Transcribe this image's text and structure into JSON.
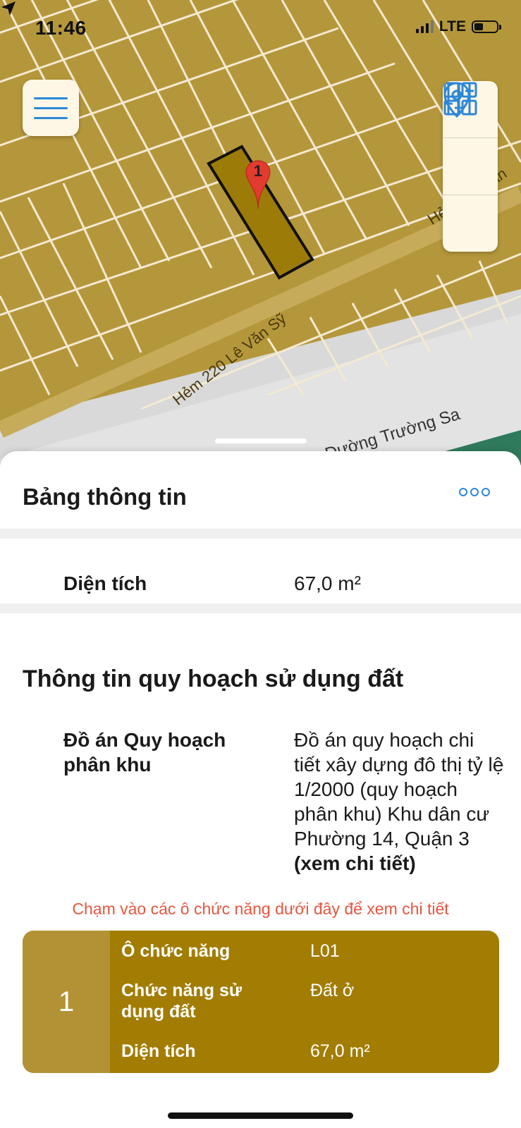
{
  "status_bar": {
    "time": "11:46",
    "network": "LTE"
  },
  "map": {
    "streets": [
      {
        "name": "Hẻm 220 Lê Văn Sỹ"
      },
      {
        "name": "Đường Trường Sa"
      },
      {
        "name": "Hẻm 2... Văn"
      }
    ],
    "marker": {
      "label": "1",
      "color": "#e23b30"
    },
    "highlight_color": "#9c7b08",
    "land_color": "#b5973b",
    "controls": [
      "menu-icon",
      "grid-icon",
      "location-pin-icon",
      "sliders-icon"
    ]
  },
  "sheet": {
    "title": "Bảng thông tin",
    "area": {
      "label": "Diện tích",
      "value": "67,0 m²"
    },
    "planning": {
      "title": "Thông tin quy hoạch sử dụng đất",
      "label": "Đồ án Quy hoạch phân khu",
      "value": "Đồ án quy hoạch chi tiết xây dựng đô thị tỷ lệ 1/2000 (quy hoạch phân khu) Khu dân cư Phường 14, Quận 3",
      "link": "(xem chi tiết)"
    },
    "hint": "Chạm vào các ô chức năng dưới đây để xem chi tiết",
    "function_card": {
      "number": "1",
      "rows": [
        {
          "label": "Ô chức năng",
          "value": "L01"
        },
        {
          "label": "Chức năng sử dụng đất",
          "value": "Đất ở"
        },
        {
          "label": "Diện tích",
          "value": "67,0 m²"
        }
      ],
      "color": "#a27d02"
    }
  }
}
